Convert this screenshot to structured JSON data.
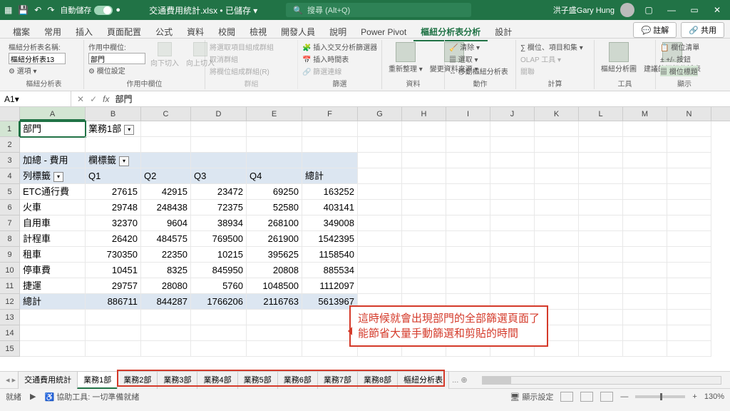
{
  "titlebar": {
    "autosave_label": "自動儲存",
    "filename": "交通費用統計.xlsx • 已儲存 ▾",
    "search_placeholder": "搜尋 (Alt+Q)",
    "user": "洪子盛Gary Hung"
  },
  "tabs": {
    "items": [
      "檔案",
      "常用",
      "插入",
      "頁面配置",
      "公式",
      "資料",
      "校閱",
      "檢視",
      "開發人員",
      "說明",
      "Power Pivot",
      "樞紐分析表分析",
      "設計"
    ],
    "active_index": 11,
    "comment": "註解",
    "share": "共用"
  },
  "ribbon": {
    "g0": {
      "label": "樞紐分析表",
      "name": "樞紐分析表名稱:",
      "nameval": "樞紐分析表13",
      "opt": "選項 ▾"
    },
    "g1": {
      "label": "作用中欄位",
      "field": "作用中欄位:",
      "fieldval": "部門",
      "set": "欄位設定",
      "down": "向下切入",
      "up": "向上切入"
    },
    "g2": {
      "label": "群組",
      "a": "將選取項目組成群組",
      "b": "取消群組",
      "c": "將欄位組成群組(R)"
    },
    "g3": {
      "label": "篩選",
      "a": "插入交叉分析篩選器",
      "b": "插入時間表",
      "c": "篩選連線"
    },
    "g4": {
      "label": "資料",
      "a": "重新整理 ▾",
      "b": "變更資料來源 ▾"
    },
    "g5": {
      "label": "動作",
      "a": "清除 ▾",
      "b": "選取 ▾",
      "c": "移動樞紐分析表"
    },
    "g6": {
      "label": "計算",
      "a": "欄位、項目和集 ▾",
      "b": "OLAP 工具 ▾",
      "c": "關聯"
    },
    "g7": {
      "label": "工具",
      "a": "樞紐分析圖",
      "b": "建議的樞紐分析表"
    },
    "g8": {
      "label": "顯示",
      "a": "欄位清單",
      "b": "+/- 按鈕",
      "c": "欄位標題"
    }
  },
  "formula": {
    "cellref": "A1",
    "value": "部門"
  },
  "grid": {
    "cols": [
      "A",
      "B",
      "C",
      "D",
      "E",
      "F",
      "G",
      "H",
      "I",
      "J",
      "K",
      "L",
      "M",
      "N"
    ],
    "r1": {
      "A": "部門",
      "B": "業務1部"
    },
    "r3": {
      "A": "加總 - 費用",
      "B": "欄標籤"
    },
    "r4": {
      "A": "列標籤",
      "B": "Q1",
      "C": "Q2",
      "D": "Q3",
      "E": "Q4",
      "F": "總計"
    },
    "data": [
      {
        "label": "ETC通行費",
        "v": [
          "27615",
          "42915",
          "23472",
          "69250",
          "163252"
        ]
      },
      {
        "label": "火車",
        "v": [
          "29748",
          "248438",
          "72375",
          "52580",
          "403141"
        ]
      },
      {
        "label": "自用車",
        "v": [
          "32370",
          "9604",
          "38934",
          "268100",
          "349008"
        ]
      },
      {
        "label": "計程車",
        "v": [
          "26420",
          "484575",
          "769500",
          "261900",
          "1542395"
        ]
      },
      {
        "label": "租車",
        "v": [
          "730350",
          "22350",
          "10215",
          "395625",
          "1158540"
        ]
      },
      {
        "label": "停車費",
        "v": [
          "10451",
          "8325",
          "845950",
          "20808",
          "885534"
        ]
      },
      {
        "label": "捷運",
        "v": [
          "29757",
          "28080",
          "5760",
          "1048500",
          "1112097"
        ]
      }
    ],
    "total": {
      "label": "總計",
      "v": [
        "886711",
        "844287",
        "1766206",
        "2116763",
        "5613967"
      ]
    }
  },
  "callout": {
    "l1": "這時候就會出現部門的全部篩選頁面了",
    "l2": "能節省大量手動篩選和剪貼的時間"
  },
  "sheets": {
    "nav": "◂ ▸",
    "items": [
      "交通費用統計",
      "業務1部",
      "業務2部",
      "業務3部",
      "業務4部",
      "業務5部",
      "業務6部",
      "業務7部",
      "業務8部",
      "樞紐分析表"
    ],
    "active_index": 1,
    "more": "... ⊕"
  },
  "status": {
    "ready": "就緒",
    "a11y": "協助工具: 一切準備就緒",
    "display": "顯示設定",
    "zoom": "130%"
  },
  "chart_data": {
    "type": "table",
    "title": "加總 - 費用 (部門: 業務1部)",
    "columns": [
      "Q1",
      "Q2",
      "Q3",
      "Q4",
      "總計"
    ],
    "rows": [
      {
        "label": "ETC通行費",
        "values": [
          27615,
          42915,
          23472,
          69250,
          163252
        ]
      },
      {
        "label": "火車",
        "values": [
          29748,
          248438,
          72375,
          52580,
          403141
        ]
      },
      {
        "label": "自用車",
        "values": [
          32370,
          9604,
          38934,
          268100,
          349008
        ]
      },
      {
        "label": "計程車",
        "values": [
          26420,
          484575,
          769500,
          261900,
          1542395
        ]
      },
      {
        "label": "租車",
        "values": [
          730350,
          22350,
          10215,
          395625,
          1158540
        ]
      },
      {
        "label": "停車費",
        "values": [
          10451,
          8325,
          845950,
          20808,
          885534
        ]
      },
      {
        "label": "捷運",
        "values": [
          29757,
          28080,
          5760,
          1048500,
          1112097
        ]
      }
    ],
    "totals": [
      886711,
      844287,
      1766206,
      2116763,
      5613967
    ]
  }
}
